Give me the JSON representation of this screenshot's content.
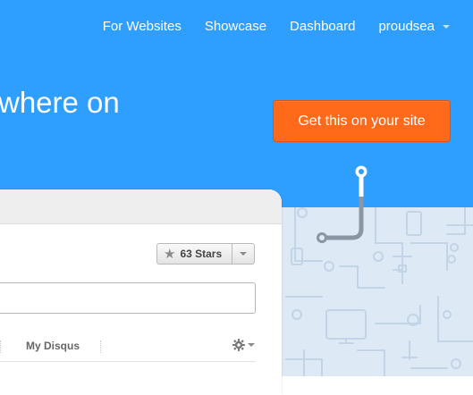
{
  "nav": {
    "links": [
      "For Websites",
      "Showcase",
      "Dashboard"
    ],
    "user": "proudsea"
  },
  "hero": {
    "headline": "where on",
    "cta_label": "Get this on your site"
  },
  "widget": {
    "stars_label": "63 Stars",
    "tab_my_disqus": "My Disqus",
    "comment_placeholder": ""
  },
  "colors": {
    "hero_bg": "#2e9fff",
    "cta_bg": "#ff6a1a",
    "pattern_bg": "#dde9f4"
  },
  "icons": {
    "stars": "star-icon",
    "settings": "gear-icon",
    "dropdown": "caret-down-icon"
  }
}
